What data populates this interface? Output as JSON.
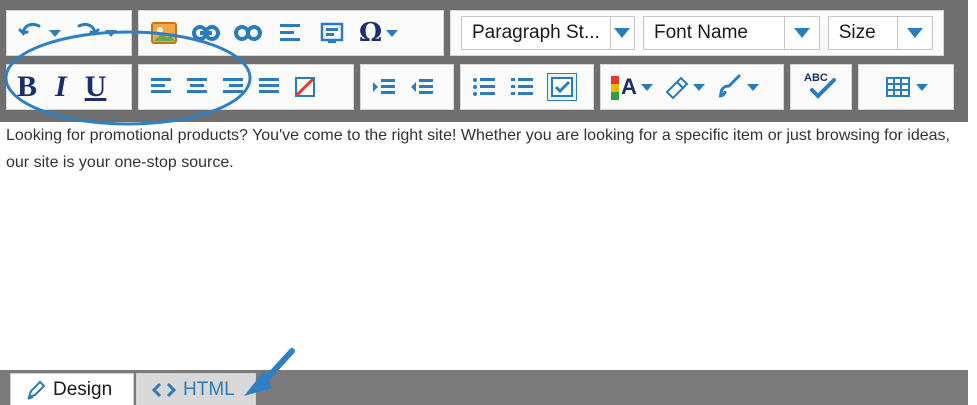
{
  "toolbar": {
    "row1": {
      "paragraph_style": "Paragraph St...",
      "font_name": "Font Name",
      "size": "Size"
    },
    "row2": {
      "bold": "B",
      "italic": "I",
      "underline": "U",
      "spellcheck_label": "ABC",
      "text_color_label": "A"
    }
  },
  "content": {
    "text": "Looking for promotional products? You've come to the right site! Whether you are looking for a specific item or just browsing for ideas, our site is your one-stop source."
  },
  "view_tabs": {
    "design": "Design",
    "html": "HTML"
  },
  "colors": {
    "toolbar_bg": "#6f6f6f",
    "accent": "#2c7bbd",
    "annotation": "#2f7fc6"
  },
  "icons": [
    "undo-icon",
    "redo-icon",
    "image-icon",
    "link-icon",
    "unlink-icon",
    "paragraph-icon",
    "media-icon",
    "omega-icon",
    "align-left-icon",
    "align-center-icon",
    "align-right-icon",
    "justify-icon",
    "clear-format-icon",
    "indent-icon",
    "outdent-icon",
    "ordered-list-icon",
    "unordered-list-icon",
    "checkbox-icon",
    "text-color-icon",
    "highlight-icon",
    "brush-icon",
    "spellcheck-icon",
    "table-icon",
    "pencil-icon",
    "code-icon"
  ]
}
